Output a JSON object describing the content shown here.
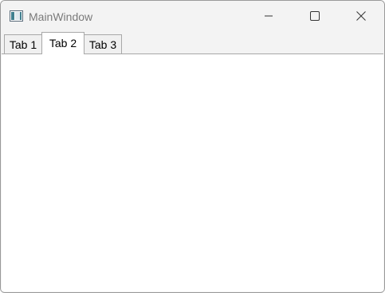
{
  "window": {
    "title": "MainWindow",
    "app_icon": "window-app-icon",
    "controls": {
      "minimize_icon": "minimize-icon",
      "maximize_icon": "maximize-icon",
      "close_icon": "close-icon"
    }
  },
  "tabs": [
    {
      "label": "Tab 1",
      "selected": false
    },
    {
      "label": "Tab 2",
      "selected": true
    },
    {
      "label": "Tab 3",
      "selected": false
    }
  ],
  "colors": {
    "titlebar_bg": "#f3f3f3",
    "title_text": "#7a7a7a",
    "pane_bg": "#ffffff",
    "tab_border": "#a8a8a8"
  }
}
